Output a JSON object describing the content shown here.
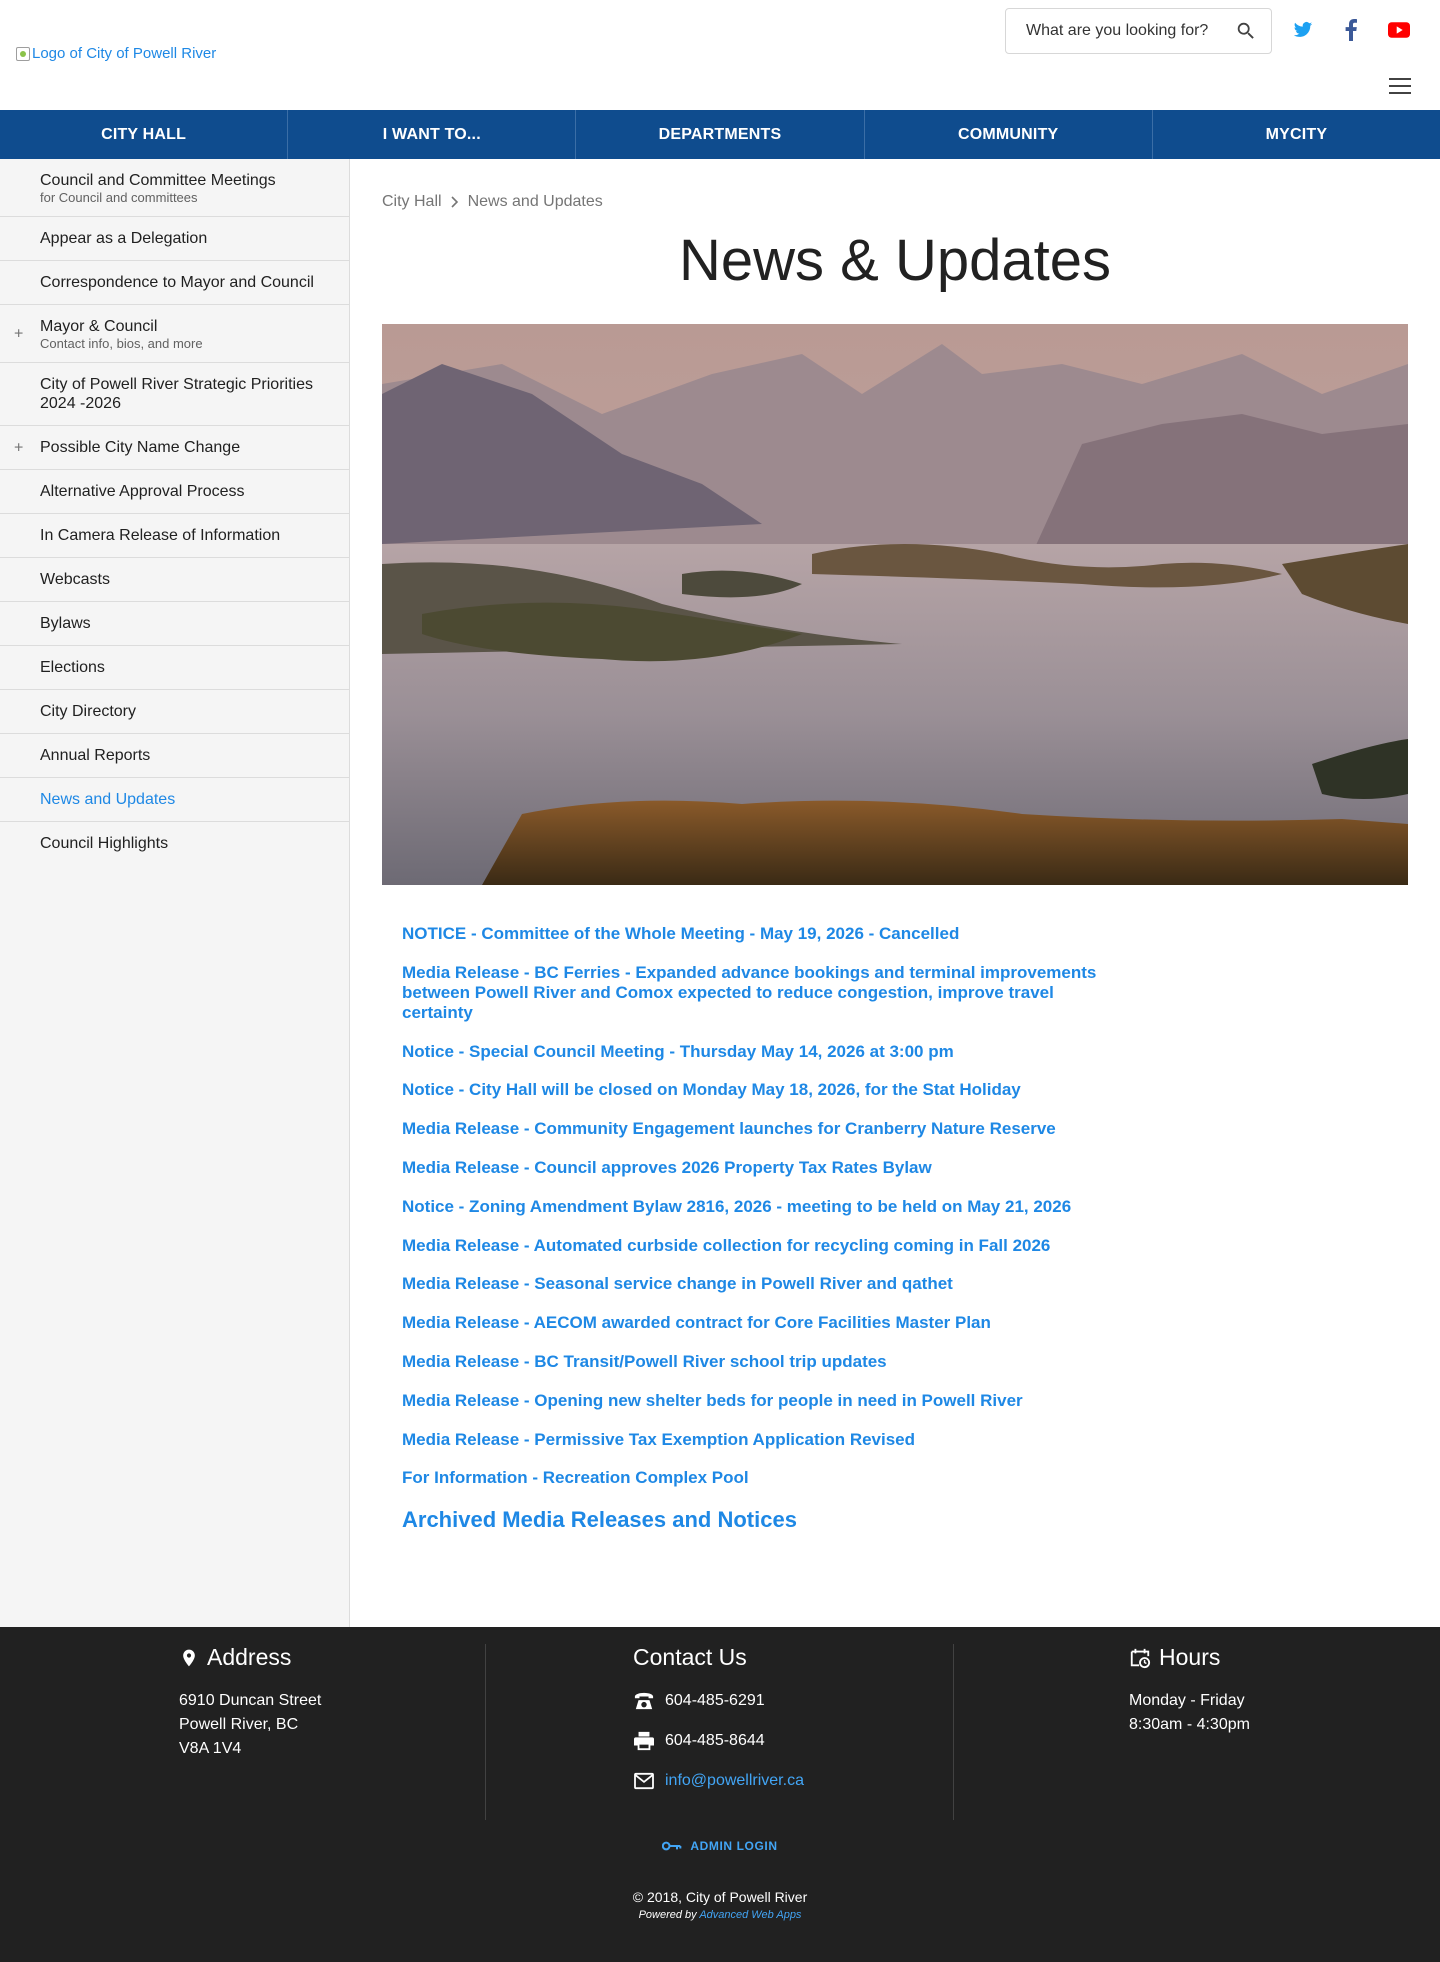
{
  "header": {
    "logo_alt": "Logo of City of Powell River",
    "search_placeholder": "What are you looking for?",
    "social": [
      "twitter-icon",
      "facebook-icon",
      "youtube-icon"
    ]
  },
  "nav": [
    "CITY HALL",
    "I WANT TO...",
    "DEPARTMENTS",
    "COMMUNITY",
    "MYCITY"
  ],
  "sidebar": {
    "items": [
      {
        "label": "Council and Committee Meetings",
        "sub": "for Council and committees",
        "plus": ""
      },
      {
        "label": "Appear as a Delegation",
        "sub": "",
        "plus": ""
      },
      {
        "label": "Correspondence to Mayor and Council",
        "sub": "",
        "plus": ""
      },
      {
        "label": "Mayor & Council",
        "sub": "Contact info, bios, and more",
        "plus": "+"
      },
      {
        "label": "City of Powell River Strategic Priorities 2024 -2026",
        "sub": "",
        "plus": ""
      },
      {
        "label": "Possible City Name Change",
        "sub": "",
        "plus": "+"
      },
      {
        "label": "Alternative Approval Process",
        "sub": "",
        "plus": ""
      },
      {
        "label": "In Camera Release of Information",
        "sub": "",
        "plus": ""
      },
      {
        "label": "Webcasts",
        "sub": "",
        "plus": ""
      },
      {
        "label": "Bylaws",
        "sub": "",
        "plus": ""
      },
      {
        "label": "Elections",
        "sub": "",
        "plus": ""
      },
      {
        "label": "City Directory",
        "sub": "",
        "plus": ""
      },
      {
        "label": "Annual Reports",
        "sub": "",
        "plus": ""
      },
      {
        "label": "News and Updates",
        "sub": "",
        "plus": ""
      },
      {
        "label": "Council Highlights",
        "sub": "",
        "plus": ""
      }
    ],
    "active": "News and Updates"
  },
  "breadcrumb": {
    "parent": "City Hall",
    "current": "News and Updates"
  },
  "page_title": "News & Updates",
  "news": [
    "NOTICE - Committee of the Whole Meeting - May 19, 2026 - Cancelled",
    "Media Release - BC Ferries - Expanded advance bookings and terminal improvements between Powell River and Comox expected to reduce congestion, improve travel certainty",
    "Notice - Special Council Meeting - Thursday May 14, 2026 at 3:00 pm",
    "Notice - City Hall will be closed on Monday May 18, 2026, for the Stat Holiday",
    "Media Release - Community Engagement launches for Cranberry Nature Reserve",
    "Media Release - Council approves 2026 Property Tax Rates Bylaw",
    "Notice - Zoning Amendment Bylaw 2816, 2026 - meeting to be held on May 21, 2026",
    "Media Release - Automated curbside collection for recycling coming in Fall 2026",
    "Media Release - Seasonal service change in Powell River and qathet",
    "Media Release - AECOM awarded contract for Core Facilities Master Plan",
    "Media Release - BC Transit/Powell River school trip updates",
    "Media Release - Opening new shelter beds for people in need in Powell River",
    "Media Release - Permissive Tax Exemption Application Revised",
    "For Information - Recreation Complex Pool"
  ],
  "archive_link": "Archived Media Releases and Notices",
  "footer": {
    "address": {
      "title": "Address",
      "line1": "6910 Duncan Street",
      "line2": "Powell River, BC",
      "line3": "V8A 1V4"
    },
    "contact": {
      "title": "Contact Us",
      "phone": "604-485-6291",
      "fax": "604-485-8644",
      "email": "info@powellriver.ca"
    },
    "hours": {
      "title": "Hours",
      "line1": "Monday - Friday",
      "line2": "8:30am - 4:30pm"
    },
    "admin_login": "ADMIN LOGIN",
    "copyright": "© 2018, City of Powell River",
    "powered_prefix": "Powered by",
    "powered_link": "Advanced Web Apps"
  },
  "colors": {
    "nav": "#0f4c8e",
    "link": "#1e88e5",
    "footer": "#212121"
  }
}
